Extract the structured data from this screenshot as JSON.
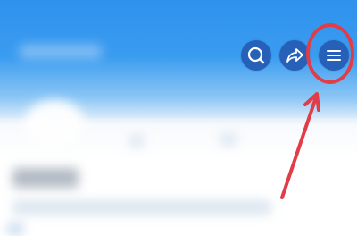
{
  "colors": {
    "header_blue": "#2f92ec",
    "button_blue": "#2660b8",
    "annotation_red": "#e03d48"
  },
  "toolbar": {
    "search_icon": "search-icon",
    "share_icon": "share-arrow-icon",
    "menu_icon": "hamburger-menu-icon"
  },
  "annotation": {
    "target": "menu-button",
    "shape": "circle-and-arrow"
  }
}
